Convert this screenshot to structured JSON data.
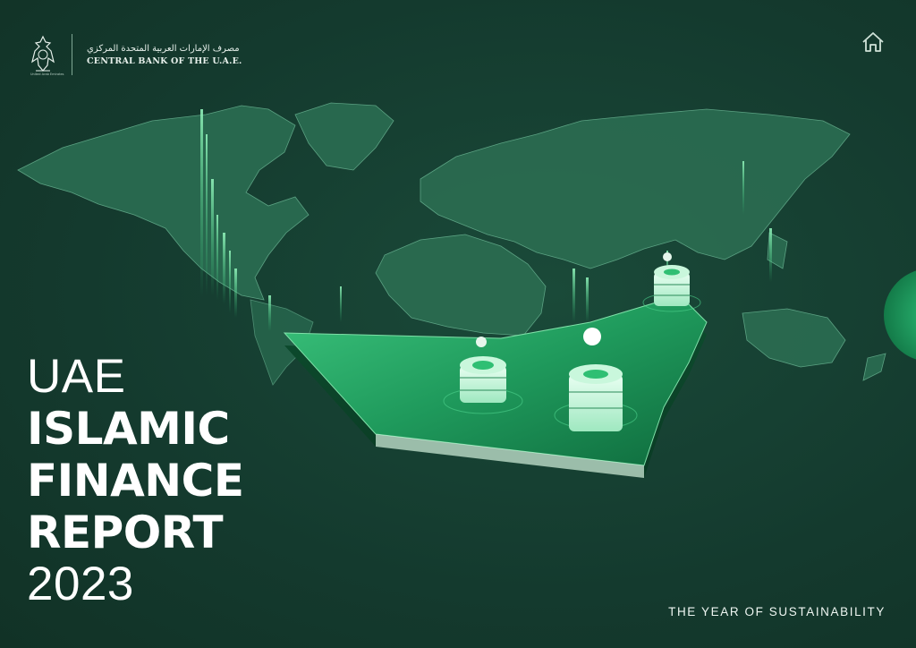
{
  "header": {
    "logo_arabic": "مصرف الإمارات العربية المتحدة المركزي",
    "logo_english": "CENTRAL BANK OF THE U.A.E.",
    "emblem_caption": "United Arab Emirates"
  },
  "icons": {
    "home": "home-icon",
    "emblem": "falcon-emblem-icon"
  },
  "title": {
    "line1": "UAE",
    "line2": "ISLAMIC",
    "line3": "FINANCE",
    "line4": "REPORT",
    "line5": "2023"
  },
  "tagline": "THE YEAR OF SUSTAINABILITY",
  "colors": {
    "background": "#143a2e",
    "map_land": "#2a6b50",
    "accent": "#2fbf73",
    "text": "#ffffff"
  }
}
